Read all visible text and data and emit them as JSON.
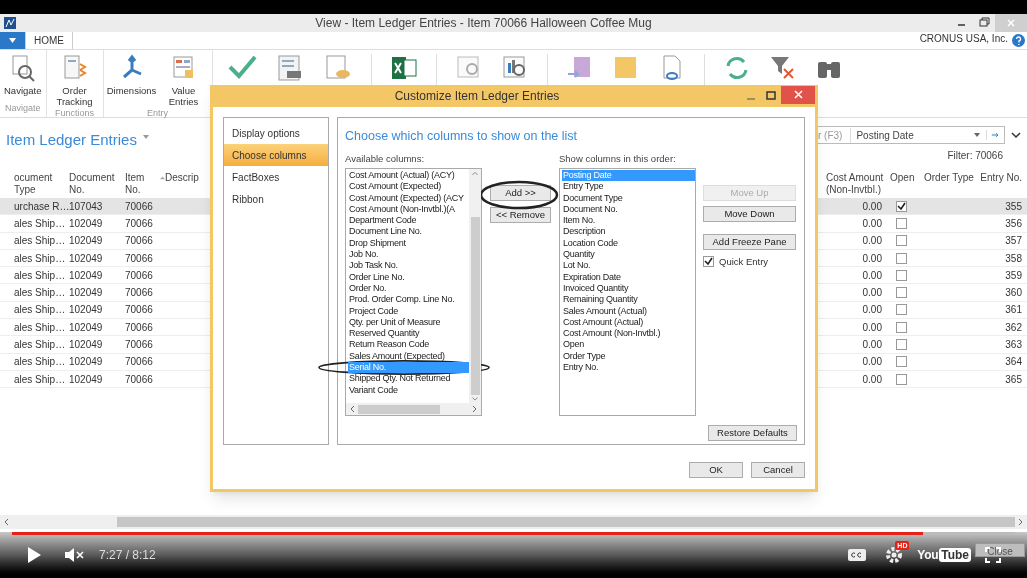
{
  "window": {
    "title": "View - Item Ledger Entries - Item 70066 Halloween Coffee Mug",
    "company": "CRONUS USA, Inc."
  },
  "ribbon": {
    "tabs": [
      {
        "label": "HOME",
        "selected": true
      }
    ],
    "groups": [
      {
        "label": "Navigate",
        "buttons": [
          "Navigate"
        ]
      },
      {
        "label": "Functions",
        "buttons": [
          "Order Tracking"
        ]
      },
      {
        "label": "Entry",
        "buttons": [
          "Dimensions",
          "Value Entries"
        ]
      }
    ]
  },
  "page": {
    "title": "Item Ledger Entries",
    "search_hint": "r (F3)",
    "search_field": "Posting Date",
    "filter": "Filter: 70066"
  },
  "table": {
    "left_columns": [
      "ocument Type",
      "Document No.",
      "Item No.",
      "Descrip"
    ],
    "right_columns": [
      "Cost Amount (Non-Invtbl.)",
      "Open",
      "Order Type",
      "Entry No."
    ],
    "rows": [
      {
        "doc_type": "urchase R…",
        "doc_no": "107043",
        "item_no": "70066",
        "cost": "0.00",
        "open": true,
        "entry_no": "355",
        "selected": true
      },
      {
        "doc_type": "ales Ship…",
        "doc_no": "102049",
        "item_no": "70066",
        "cost": "0.00",
        "open": false,
        "entry_no": "356",
        "selected": false
      },
      {
        "doc_type": "ales Ship…",
        "doc_no": "102049",
        "item_no": "70066",
        "cost": "0.00",
        "open": false,
        "entry_no": "357",
        "selected": false
      },
      {
        "doc_type": "ales Ship…",
        "doc_no": "102049",
        "item_no": "70066",
        "cost": "0.00",
        "open": false,
        "entry_no": "358",
        "selected": false
      },
      {
        "doc_type": "ales Ship…",
        "doc_no": "102049",
        "item_no": "70066",
        "cost": "0.00",
        "open": false,
        "entry_no": "359",
        "selected": false
      },
      {
        "doc_type": "ales Ship…",
        "doc_no": "102049",
        "item_no": "70066",
        "cost": "0.00",
        "open": false,
        "entry_no": "360",
        "selected": false
      },
      {
        "doc_type": "ales Ship…",
        "doc_no": "102049",
        "item_no": "70066",
        "cost": "0.00",
        "open": false,
        "entry_no": "361",
        "selected": false
      },
      {
        "doc_type": "ales Ship…",
        "doc_no": "102049",
        "item_no": "70066",
        "cost": "0.00",
        "open": false,
        "entry_no": "362",
        "selected": false
      },
      {
        "doc_type": "ales Ship…",
        "doc_no": "102049",
        "item_no": "70066",
        "cost": "0.00",
        "open": false,
        "entry_no": "363",
        "selected": false
      },
      {
        "doc_type": "ales Ship…",
        "doc_no": "102049",
        "item_no": "70066",
        "cost": "0.00",
        "open": false,
        "entry_no": "364",
        "selected": false
      },
      {
        "doc_type": "ales Ship…",
        "doc_no": "102049",
        "item_no": "70066",
        "cost": "0.00",
        "open": false,
        "entry_no": "365",
        "selected": false
      }
    ]
  },
  "dialog": {
    "title": "Customize Item Ledger Entries",
    "nav": [
      {
        "label": "Display options",
        "selected": false
      },
      {
        "label": "Choose columns",
        "selected": true
      },
      {
        "label": "FactBoxes",
        "selected": false
      },
      {
        "label": "Ribbon",
        "selected": false
      }
    ],
    "heading": "Choose which columns to show on the list",
    "available_label": "Available columns:",
    "available": [
      {
        "label": "Cost Amount (Actual) (ACY)",
        "selected": false
      },
      {
        "label": "Cost Amount (Expected)",
        "selected": false
      },
      {
        "label": "Cost Amount (Expected) (ACY",
        "selected": false
      },
      {
        "label": "Cost Amount (Non-Invtbl.)(A",
        "selected": false
      },
      {
        "label": "Department Code",
        "selected": false
      },
      {
        "label": "Document Line No.",
        "selected": false
      },
      {
        "label": "Drop Shipment",
        "selected": false
      },
      {
        "label": "Job No.",
        "selected": false
      },
      {
        "label": "Job Task No.",
        "selected": false
      },
      {
        "label": "Order Line No.",
        "selected": false
      },
      {
        "label": "Order No.",
        "selected": false
      },
      {
        "label": "Prod. Order Comp. Line No.",
        "selected": false
      },
      {
        "label": "Project Code",
        "selected": false
      },
      {
        "label": "Qty. per Unit of Measure",
        "selected": false
      },
      {
        "label": "Reserved Quantity",
        "selected": false
      },
      {
        "label": "Return Reason Code",
        "selected": false
      },
      {
        "label": "Sales Amount (Expected)",
        "selected": false
      },
      {
        "label": "Serial No.",
        "selected": true
      },
      {
        "label": "Shipped Qty. Not Returned",
        "selected": false
      },
      {
        "label": "Variant Code",
        "selected": false
      }
    ],
    "add_button": "Add >>",
    "remove_button": "<< Remove",
    "shown_label": "Show columns in this order:",
    "shown": [
      {
        "label": "Posting Date",
        "selected": true
      },
      {
        "label": "Entry Type",
        "selected": false
      },
      {
        "label": "Document Type",
        "selected": false
      },
      {
        "label": "Document No.",
        "selected": false
      },
      {
        "label": "Item No.",
        "selected": false
      },
      {
        "label": "Description",
        "selected": false
      },
      {
        "label": "Location Code",
        "selected": false
      },
      {
        "label": "Quantity",
        "selected": false
      },
      {
        "label": "Lot No.",
        "selected": false
      },
      {
        "label": "Expiration Date",
        "selected": false
      },
      {
        "label": "Invoiced Quantity",
        "selected": false
      },
      {
        "label": "Remaining Quantity",
        "selected": false
      },
      {
        "label": "Sales Amount (Actual)",
        "selected": false
      },
      {
        "label": "Cost Amount (Actual)",
        "selected": false
      },
      {
        "label": "Cost Amount (Non-Invtbl.)",
        "selected": false
      },
      {
        "label": "Open",
        "selected": false
      },
      {
        "label": "Order Type",
        "selected": false
      },
      {
        "label": "Entry No.",
        "selected": false
      }
    ],
    "side_buttons": [
      {
        "label": "Move Up",
        "disabled": true
      },
      {
        "label": "Move Down",
        "disabled": false
      },
      {
        "label": "Add Freeze Pane",
        "disabled": false
      }
    ],
    "quick_entry": {
      "label": "Quick Entry",
      "checked": true
    },
    "restore_button": "Restore Defaults",
    "ok_button": "OK",
    "cancel_button": "Cancel"
  },
  "footer": {
    "close_button": "Close"
  },
  "player": {
    "level": 0.908,
    "time": "7:27 / 8:12",
    "hd_badge": "HD",
    "logo_left": "You",
    "logo_right": "Tube"
  }
}
